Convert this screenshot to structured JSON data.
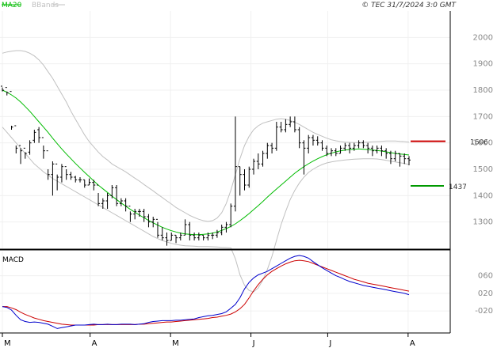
{
  "header": {
    "legend_ma": "MA20",
    "legend_bb": "BBands",
    "copyright": "© TEC 31/7/2024 3:0 GMT"
  },
  "colors": {
    "price": "#000000",
    "ma20": "#00bb00",
    "bbands": "#c0c0c0",
    "resistance": "#cc0000",
    "support": "#009900",
    "macd": "#0000cc",
    "signal": "#cc0000",
    "panel_bg": "#f0f0f0",
    "axis_text": "#888888"
  },
  "chart_data": [
    {
      "type": "line",
      "title": "",
      "ylim": [
        1200,
        2100
      ],
      "y_ticks": [
        1300,
        1400,
        1500,
        1600,
        1700,
        1800,
        1900,
        2000
      ],
      "month_labels": [
        {
          "label": "M",
          "x": 0
        },
        {
          "label": "A",
          "x": 24
        },
        {
          "label": "M",
          "x": 46
        },
        {
          "label": "J",
          "x": 68
        },
        {
          "label": "J",
          "x": 89
        },
        {
          "label": "A",
          "x": 111
        }
      ],
      "levels": [
        {
          "label": "1606",
          "value": 1606,
          "kind": "resistance"
        },
        {
          "label": "1437",
          "value": 1437,
          "kind": "support"
        }
      ],
      "price_bars": [
        [
          1815,
          1800,
          1795,
          1810
        ],
        [
          1810,
          1790,
          1780,
          1795
        ],
        [
          1795,
          1660,
          1650,
          1665
        ],
        [
          1665,
          1580,
          1560,
          1590
        ],
        [
          1590,
          1570,
          1520,
          1580
        ],
        [
          1580,
          1560,
          1540,
          1565
        ],
        [
          1565,
          1600,
          1555,
          1610
        ],
        [
          1610,
          1640,
          1600,
          1650
        ],
        [
          1650,
          1620,
          1600,
          1660
        ],
        [
          1620,
          1570,
          1540,
          1590
        ],
        [
          1570,
          1480,
          1460,
          1500
        ],
        [
          1480,
          1520,
          1400,
          1530
        ],
        [
          1520,
          1470,
          1420,
          1480
        ],
        [
          1470,
          1510,
          1450,
          1520
        ],
        [
          1510,
          1480,
          1460,
          1500
        ],
        [
          1480,
          1470,
          1460,
          1490
        ],
        [
          1470,
          1460,
          1450,
          1475
        ],
        [
          1460,
          1460,
          1450,
          1470
        ],
        [
          1460,
          1440,
          1430,
          1460
        ],
        [
          1440,
          1450,
          1440,
          1465
        ],
        [
          1450,
          1440,
          1420,
          1460
        ],
        [
          1440,
          1370,
          1360,
          1410
        ],
        [
          1370,
          1380,
          1350,
          1390
        ],
        [
          1380,
          1400,
          1350,
          1410
        ],
        [
          1400,
          1430,
          1390,
          1440
        ],
        [
          1430,
          1370,
          1360,
          1440
        ],
        [
          1370,
          1380,
          1360,
          1390
        ],
        [
          1380,
          1360,
          1340,
          1390
        ],
        [
          1360,
          1330,
          1300,
          1340
        ],
        [
          1330,
          1340,
          1310,
          1350
        ],
        [
          1340,
          1340,
          1320,
          1350
        ],
        [
          1340,
          1320,
          1300,
          1350
        ],
        [
          1320,
          1300,
          1280,
          1330
        ],
        [
          1300,
          1310,
          1280,
          1320
        ],
        [
          1310,
          1250,
          1240,
          1300
        ],
        [
          1250,
          1240,
          1230,
          1280
        ],
        [
          1240,
          1230,
          1210,
          1260
        ],
        [
          1230,
          1250,
          1230,
          1260
        ],
        [
          1250,
          1240,
          1220,
          1250
        ],
        [
          1240,
          1250,
          1230,
          1260
        ],
        [
          1250,
          1290,
          1250,
          1310
        ],
        [
          1290,
          1250,
          1230,
          1300
        ],
        [
          1250,
          1240,
          1230,
          1260
        ],
        [
          1240,
          1250,
          1230,
          1260
        ],
        [
          1250,
          1240,
          1230,
          1250
        ],
        [
          1240,
          1250,
          1230,
          1260
        ],
        [
          1250,
          1250,
          1235,
          1260
        ],
        [
          1250,
          1260,
          1240,
          1270
        ],
        [
          1260,
          1280,
          1250,
          1290
        ],
        [
          1280,
          1290,
          1260,
          1300
        ],
        [
          1290,
          1360,
          1280,
          1370
        ],
        [
          1360,
          1510,
          1340,
          1700
        ],
        [
          1510,
          1480,
          1400,
          1510
        ],
        [
          1480,
          1440,
          1420,
          1500
        ],
        [
          1440,
          1500,
          1430,
          1510
        ],
        [
          1500,
          1530,
          1480,
          1540
        ],
        [
          1530,
          1520,
          1500,
          1560
        ],
        [
          1520,
          1560,
          1510,
          1570
        ],
        [
          1560,
          1590,
          1540,
          1600
        ],
        [
          1590,
          1580,
          1560,
          1600
        ],
        [
          1580,
          1660,
          1570,
          1680
        ],
        [
          1660,
          1650,
          1640,
          1680
        ],
        [
          1650,
          1670,
          1640,
          1690
        ],
        [
          1670,
          1680,
          1660,
          1700
        ],
        [
          1680,
          1650,
          1640,
          1700
        ],
        [
          1650,
          1600,
          1580,
          1660
        ],
        [
          1600,
          1580,
          1480,
          1610
        ],
        [
          1580,
          1620,
          1560,
          1630
        ],
        [
          1620,
          1610,
          1590,
          1630
        ],
        [
          1610,
          1600,
          1590,
          1625
        ],
        [
          1600,
          1580,
          1570,
          1610
        ],
        [
          1580,
          1560,
          1550,
          1590
        ],
        [
          1560,
          1570,
          1550,
          1580
        ],
        [
          1570,
          1560,
          1550,
          1580
        ],
        [
          1560,
          1580,
          1560,
          1590
        ],
        [
          1580,
          1590,
          1570,
          1600
        ],
        [
          1590,
          1580,
          1560,
          1600
        ],
        [
          1580,
          1590,
          1570,
          1600
        ],
        [
          1590,
          1600,
          1580,
          1610
        ],
        [
          1600,
          1590,
          1580,
          1610
        ],
        [
          1590,
          1580,
          1560,
          1600
        ],
        [
          1580,
          1570,
          1550,
          1590
        ],
        [
          1570,
          1580,
          1560,
          1590
        ],
        [
          1580,
          1570,
          1550,
          1590
        ],
        [
          1570,
          1560,
          1540,
          1580
        ],
        [
          1560,
          1540,
          1520,
          1570
        ],
        [
          1540,
          1560,
          1530,
          1570
        ],
        [
          1560,
          1550,
          1510,
          1560
        ],
        [
          1550,
          1540,
          1520,
          1560
        ],
        [
          1540,
          1535,
          1515,
          1550
        ]
      ],
      "ma20": [
        1800,
        1792,
        1782,
        1770,
        1755,
        1738,
        1720,
        1700,
        1680,
        1660,
        1640,
        1618,
        1597,
        1577,
        1558,
        1540,
        1522,
        1505,
        1488,
        1472,
        1456,
        1440,
        1426,
        1412,
        1398,
        1385,
        1372,
        1360,
        1348,
        1337,
        1326,
        1316,
        1306,
        1297,
        1288,
        1280,
        1273,
        1267,
        1262,
        1258,
        1255,
        1253,
        1252,
        1252,
        1253,
        1255,
        1258,
        1262,
        1268,
        1275,
        1283,
        1293,
        1305,
        1318,
        1332,
        1347,
        1362,
        1378,
        1394,
        1410,
        1425,
        1440,
        1455,
        1470,
        1485,
        1498,
        1510,
        1521,
        1531,
        1540,
        1548,
        1555,
        1561,
        1566,
        1570,
        1573,
        1575,
        1576,
        1577,
        1576,
        1575,
        1573,
        1571,
        1569,
        1566,
        1563,
        1560,
        1558,
        1556,
        1554
      ],
      "bb_upper": [
        1940,
        1945,
        1948,
        1950,
        1950,
        1947,
        1940,
        1930,
        1915,
        1895,
        1870,
        1845,
        1815,
        1785,
        1755,
        1720,
        1690,
        1660,
        1630,
        1605,
        1585,
        1565,
        1548,
        1535,
        1520,
        1510,
        1500,
        1490,
        1478,
        1466,
        1455,
        1442,
        1430,
        1418,
        1405,
        1393,
        1380,
        1368,
        1355,
        1345,
        1335,
        1325,
        1317,
        1310,
        1305,
        1302,
        1305,
        1315,
        1335,
        1370,
        1420,
        1480,
        1540,
        1590,
        1625,
        1650,
        1665,
        1675,
        1680,
        1685,
        1690,
        1692,
        1690,
        1685,
        1678,
        1670,
        1660,
        1650,
        1640,
        1632,
        1625,
        1618,
        1612,
        1608,
        1605,
        1603,
        1602,
        1601,
        1601,
        1602,
        1603,
        1604,
        1605,
        1606,
        1607,
        1607,
        1607,
        1606,
        1605,
        1603
      ],
      "bb_lower": [
        1660,
        1640,
        1620,
        1600,
        1580,
        1560,
        1540,
        1520,
        1505,
        1490,
        1478,
        1465,
        1455,
        1445,
        1435,
        1425,
        1415,
        1405,
        1395,
        1385,
        1375,
        1365,
        1355,
        1345,
        1335,
        1325,
        1315,
        1305,
        1295,
        1285,
        1275,
        1265,
        1255,
        1245,
        1237,
        1230,
        1224,
        1219,
        1215,
        1212,
        1210,
        1209,
        1208,
        1207,
        1207,
        1207,
        1206,
        1205,
        1204,
        1203,
        1202,
        1160,
        1100,
        1060,
        1040,
        1035,
        1050,
        1080,
        1120,
        1170,
        1230,
        1290,
        1340,
        1385,
        1420,
        1448,
        1470,
        1488,
        1500,
        1510,
        1518,
        1524,
        1528,
        1531,
        1533,
        1535,
        1537,
        1538,
        1539,
        1540,
        1540,
        1540,
        1539,
        1537,
        1534,
        1531,
        1528,
        1525,
        1522,
        1518
      ]
    },
    {
      "type": "line",
      "title": "MACD",
      "ylim": [
        -70,
        115
      ],
      "y_ticks": [
        -20,
        20,
        60
      ],
      "y_tick_labels": [
        "-020",
        "020",
        "060"
      ],
      "series": [
        {
          "name": "MACD",
          "values": [
            -10,
            -12,
            -18,
            -30,
            -40,
            -44,
            -46,
            -45,
            -46,
            -48,
            -50,
            -55,
            -60,
            -58,
            -56,
            -54,
            -52,
            -52,
            -52,
            -51,
            -50,
            -51,
            -51,
            -50,
            -51,
            -51,
            -50,
            -50,
            -50,
            -51,
            -50,
            -49,
            -46,
            -44,
            -43,
            -42,
            -42,
            -42,
            -41,
            -41,
            -40,
            -39,
            -38,
            -35,
            -33,
            -31,
            -30,
            -28,
            -26,
            -22,
            -14,
            -5,
            10,
            30,
            45,
            55,
            62,
            66,
            70,
            76,
            82,
            88,
            94,
            100,
            104,
            106,
            104,
            100,
            92,
            85,
            78,
            72,
            66,
            60,
            56,
            51,
            47,
            44,
            41,
            38,
            36,
            34,
            32,
            30,
            28,
            26,
            24,
            22,
            20,
            17
          ]
        },
        {
          "name": "Signal",
          "values": [
            -10,
            -10,
            -13,
            -17,
            -23,
            -28,
            -32,
            -36,
            -39,
            -42,
            -44,
            -46,
            -48,
            -50,
            -51,
            -52,
            -52,
            -52,
            -52,
            -52,
            -52,
            -51,
            -51,
            -51,
            -51,
            -51,
            -51,
            -51,
            -51,
            -51,
            -50,
            -50,
            -49,
            -48,
            -47,
            -46,
            -45,
            -45,
            -44,
            -43,
            -42,
            -41,
            -40,
            -39,
            -38,
            -37,
            -35,
            -34,
            -32,
            -30,
            -27,
            -22,
            -15,
            -5,
            10,
            26,
            40,
            52,
            62,
            70,
            76,
            82,
            87,
            91,
            94,
            95,
            94,
            92,
            88,
            84,
            80,
            76,
            72,
            68,
            64,
            60,
            56,
            52,
            49,
            46,
            43,
            41,
            39,
            37,
            35,
            33,
            31,
            29,
            27,
            25
          ]
        }
      ]
    }
  ]
}
